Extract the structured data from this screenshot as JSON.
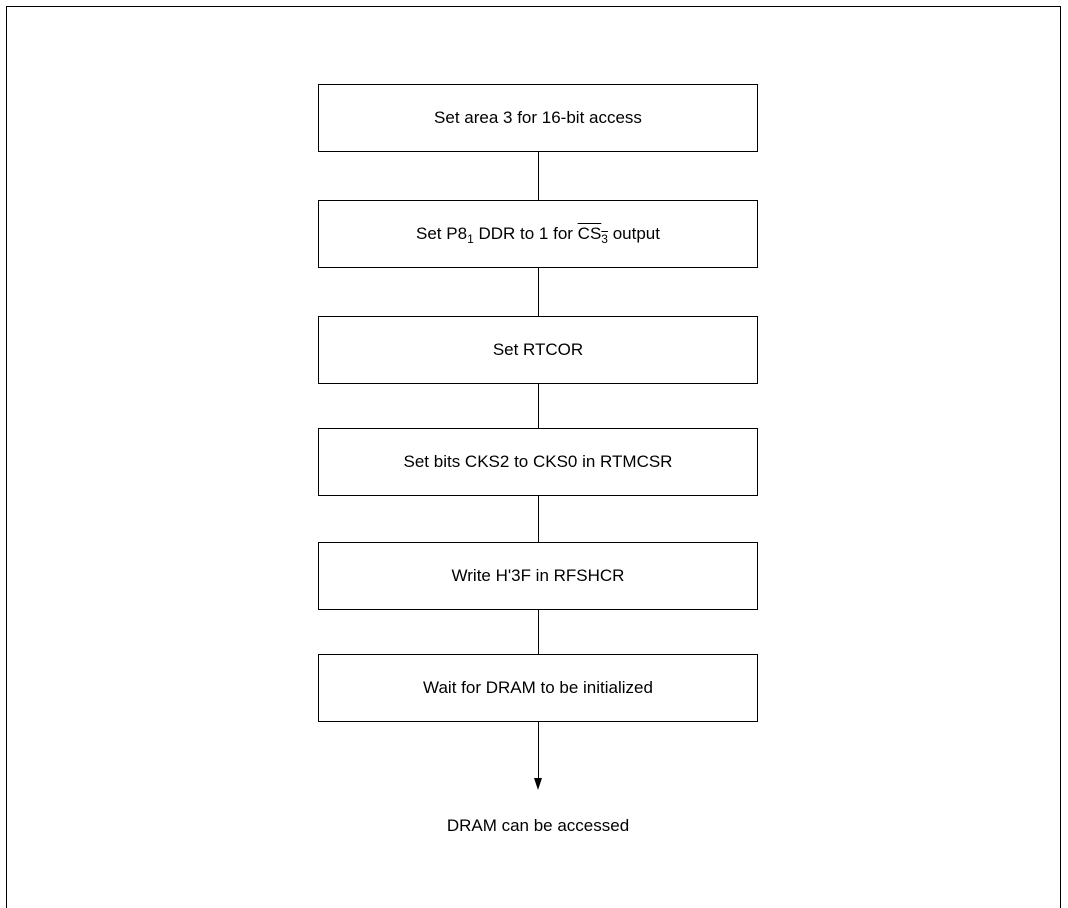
{
  "steps": [
    {
      "text": "Set area 3 for 16-bit access"
    },
    {
      "pre": "Set P8",
      "sub1": "1",
      "mid": " DDR to 1 for ",
      "cs": "CS",
      "sub2": "3",
      "post": " output"
    },
    {
      "text": "Set RTCOR"
    },
    {
      "text": "Set bits CKS2 to CKS0 in RTMCSR"
    },
    {
      "text": "Write H'3F in RFSHCR"
    },
    {
      "text": "Wait for DRAM to be initialized"
    }
  ],
  "end_label": "DRAM can be accessed"
}
